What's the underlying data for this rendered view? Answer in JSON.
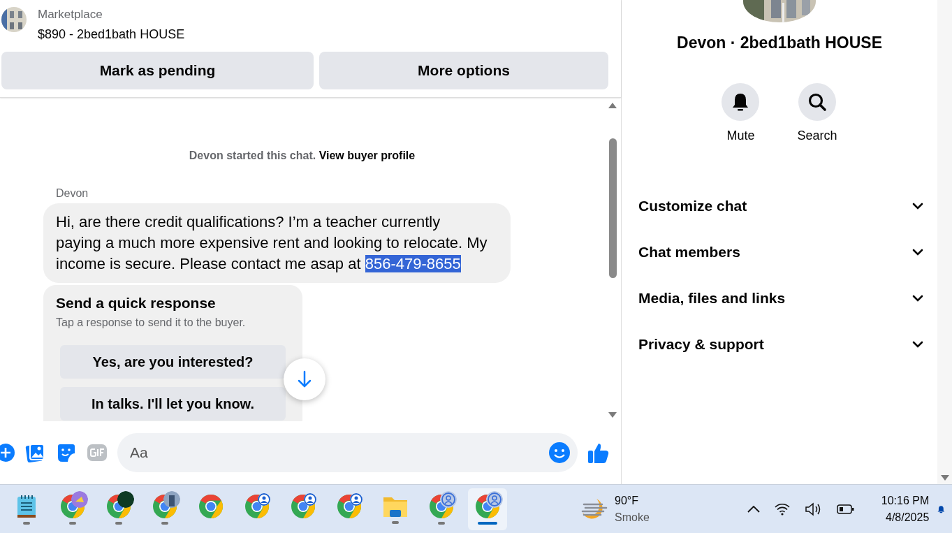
{
  "listing": {
    "source": "Marketplace",
    "title": "$890 - 2bed1bath HOUSE"
  },
  "listing_actions": [
    "Mark as pending",
    "More options"
  ],
  "chat": {
    "intro": "Devon started this chat.",
    "intro_link": "View buyer profile",
    "sender": "Devon",
    "message": {
      "text": "Hi, are there credit qualifications? I’m a teacher currently paying a much more expensive rent and looking to relocate. My income is secure. Please contact me asap at",
      "highlighted": "856-479-8655"
    },
    "quick_response": {
      "title": "Send a quick response",
      "hint": "Tap a response to send it to the buyer.",
      "options": [
        "Yes, are you interested?",
        "In talks. I'll let you know."
      ]
    }
  },
  "composer": {
    "placeholder": "Aa"
  },
  "details": {
    "title": "Devon · 2bed1bath HOUSE",
    "actions": [
      {
        "kind": "mute",
        "label": "Mute"
      },
      {
        "kind": "search",
        "label": "Search"
      }
    ],
    "sections": [
      {
        "label": "Customize chat",
        "expanded": false
      },
      {
        "label": "Chat members",
        "expanded": false
      },
      {
        "label": "Media, files and links",
        "expanded": false
      },
      {
        "label": "Privacy & support",
        "expanded": false
      }
    ]
  },
  "taskbar": {
    "apps": [
      {
        "kind": "notepad",
        "running": true,
        "selected": false
      },
      {
        "kind": "browser",
        "overlay": {
          "kind": "yellow"
        },
        "running": true,
        "selected": false
      },
      {
        "kind": "browser",
        "overlay": {
          "kind": "dark"
        },
        "running": true,
        "selected": false
      },
      {
        "kind": "browser",
        "running": true,
        "selected": false
      },
      {
        "kind": "browser",
        "running": false,
        "selected": false
      },
      {
        "kind": "browser",
        "overlay": {
          "kind": "profile"
        },
        "running": false,
        "selected": false
      },
      {
        "kind": "browser",
        "overlay": {
          "kind": "profile"
        },
        "running": false,
        "selected": false
      },
      {
        "kind": "browser",
        "overlay": {
          "kind": "profile"
        },
        "running": false,
        "selected": false
      },
      {
        "kind": "folder",
        "running": true,
        "selected": false
      },
      {
        "kind": "browser",
        "overlay": {
          "kind": "profilelarge"
        },
        "running": true,
        "selected": false
      },
      {
        "kind": "browser",
        "overlay": {
          "kind": "profilelarge"
        },
        "running": true,
        "selected": true
      }
    ],
    "weather": {
      "temperature": "90°F",
      "condition": "Smoke"
    },
    "time": "10:16 PM",
    "date": "4/8/2025"
  }
}
